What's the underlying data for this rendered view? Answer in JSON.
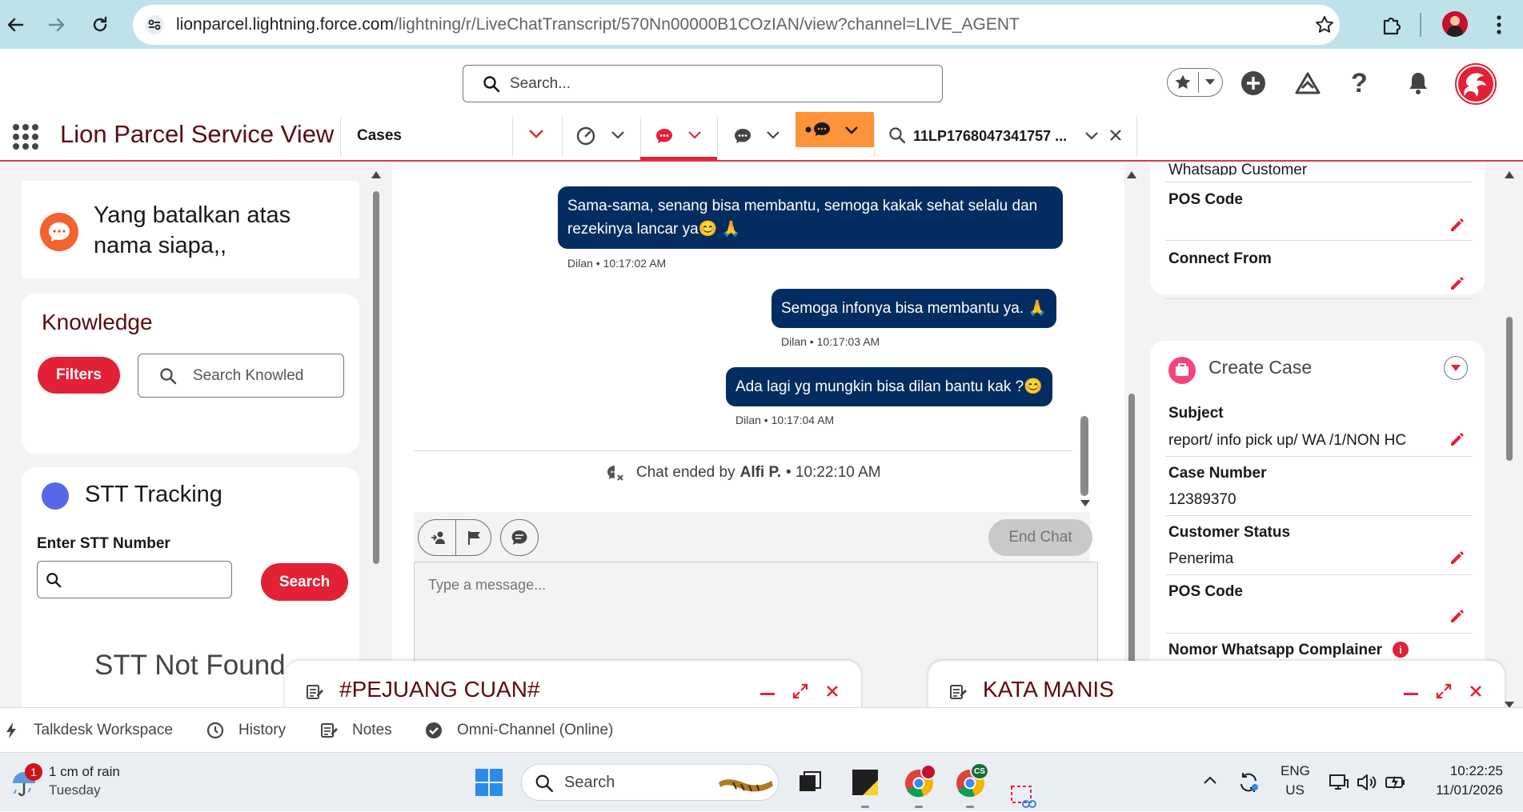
{
  "browser": {
    "url_host": "lionparcel.lightning.force.com",
    "url_path": "/lightning/r/LiveChatTranscript/570Nn00000B1COzIAN/view?channel=LIVE_AGENT"
  },
  "header": {
    "search_placeholder": "Search..."
  },
  "nav": {
    "app_name": "Lion Parcel Service View",
    "cases_label": "Cases",
    "record_tab_label": "11LP1768047341757 ..."
  },
  "left": {
    "quote_text": "Yang batalkan atas nama siapa,,",
    "knowledge_title": "Knowledge",
    "filters_label": "Filters",
    "knowledge_search_placeholder": "Search Knowled",
    "stt_title": "STT Tracking",
    "stt_input_label": "Enter STT Number",
    "stt_search_label": "Search",
    "stt_not_found": "STT Not Found"
  },
  "chat": {
    "messages": [
      {
        "text": "Sama-sama, senang bisa membantu, semoga kakak sehat selalu dan rezekinya lancar ya😊 🙏",
        "meta": "Dilan • 10:17:02 AM"
      },
      {
        "text": "Semoga infonya bisa membantu ya. 🙏",
        "meta": "Dilan • 10:17:03 AM"
      },
      {
        "text": "Ada lagi yg mungkin bisa dilan bantu kak ?😊",
        "meta": "Dilan • 10:17:04 AM"
      }
    ],
    "ended_prefix": "Chat ended by",
    "ended_by": "Alfi P.",
    "ended_time": "• 10:22:10 AM",
    "end_chat_label": "End Chat",
    "message_placeholder": "Type a message..."
  },
  "right": {
    "top_field_partial": "Whatsapp Customer",
    "pos_code_label": "POS Code",
    "connect_from_label": "Connect From",
    "create_case_title": "Create Case",
    "fields": [
      {
        "label": "Subject",
        "value": "report/ info pick up/ WA /1/NON HC"
      },
      {
        "label": "Case Number",
        "value": "12389370"
      },
      {
        "label": "Customer Status",
        "value": "Penerima"
      },
      {
        "label": "POS Code",
        "value": ""
      },
      {
        "label": "Nomor Whatsapp Complainer",
        "value": ""
      }
    ]
  },
  "popups": {
    "left_title": "#PEJUANG CUAN#",
    "right_title": "KATA MANIS"
  },
  "utility": {
    "talkdesk": "Talkdesk Workspace",
    "history": "History",
    "notes": "Notes",
    "omni": "Omni-Channel (Online)"
  },
  "taskbar": {
    "weather_badge": "1",
    "weather_line1": "1 cm of rain",
    "weather_line2": "Tuesday",
    "search_label": "Search",
    "lang_line1": "ENG",
    "lang_line2": "US",
    "time": "10:22:25",
    "date": "11/01/2026",
    "chrome_badge": "CS"
  },
  "colors": {
    "brand_red": "#e32136",
    "chat_bubble": "#032d60",
    "header_bg": "#bde2ea",
    "app_name": "#5c0b0f"
  }
}
